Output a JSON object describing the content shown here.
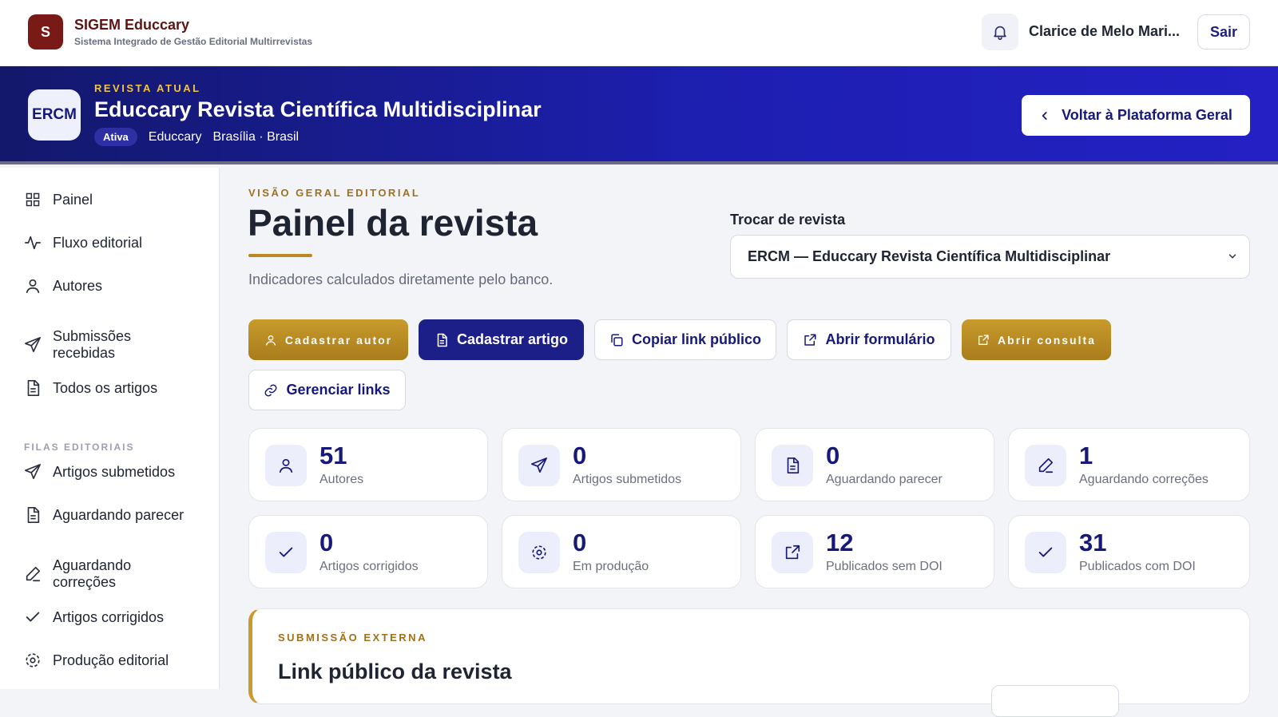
{
  "app": {
    "logo_letter": "S",
    "name": "SIGEM Educcary",
    "subtitle": "Sistema Integrado de Gestão Editorial Multirrevistas",
    "user_name": "Clarice de Melo Mari...",
    "logout_label": "Sair"
  },
  "journal": {
    "kicker": "REVISTA ATUAL",
    "badge": "ERCM",
    "title": "Educcary Revista Científica Multidisciplinar",
    "status": "Ativa",
    "publisher": "Educcary",
    "location": "Brasília · Brasil",
    "back_label": "Voltar à Plataforma Geral"
  },
  "sidebar": {
    "items": [
      {
        "label": "Painel",
        "icon": "grid-icon"
      },
      {
        "label": "Fluxo editorial",
        "icon": "activity-icon"
      },
      {
        "label": "Autores",
        "icon": "user-icon"
      },
      {
        "label": "Submissões recebidas",
        "icon": "send-icon"
      },
      {
        "label": "Todos os artigos",
        "icon": "document-icon"
      }
    ],
    "section_title": "FILAS EDITORIAIS",
    "queue_items": [
      {
        "label": "Artigos submetidos",
        "icon": "send-icon"
      },
      {
        "label": "Aguardando parecer",
        "icon": "document-icon"
      },
      {
        "label": "Aguardando correções",
        "icon": "pen-icon"
      },
      {
        "label": "Artigos corrigidos",
        "icon": "check-icon"
      },
      {
        "label": "Produção editorial",
        "icon": "gear-icon"
      }
    ]
  },
  "main": {
    "kicker": "VISÃO GERAL EDITORIAL",
    "title": "Painel da revista",
    "subtitle": "Indicadores calculados diretamente pelo banco.",
    "switch_label": "Trocar de revista",
    "switch_value": "ERCM — Educcary Revista Científica Multidisciplinar",
    "actions": {
      "add_author": "Cadastrar autor",
      "add_article": "Cadastrar artigo",
      "copy_link": "Copiar link público",
      "open_form": "Abrir formulário",
      "open_query": "Abrir consulta",
      "manage_links": "Gerenciar links"
    },
    "stats": [
      {
        "value": "51",
        "label": "Autores",
        "icon": "user-icon"
      },
      {
        "value": "0",
        "label": "Artigos submetidos",
        "icon": "send-icon"
      },
      {
        "value": "0",
        "label": "Aguardando parecer",
        "icon": "document-icon"
      },
      {
        "value": "1",
        "label": "Aguardando correções",
        "icon": "pen-icon"
      },
      {
        "value": "0",
        "label": "Artigos corrigidos",
        "icon": "check-icon"
      },
      {
        "value": "0",
        "label": "Em produção",
        "icon": "gear-icon"
      },
      {
        "value": "12",
        "label": "Publicados sem DOI",
        "icon": "external-link-icon"
      },
      {
        "value": "31",
        "label": "Publicados com DOI",
        "icon": "check-icon"
      }
    ],
    "external": {
      "kicker": "SUBMISSÃO EXTERNA",
      "title": "Link público da revista"
    }
  },
  "colors": {
    "brand_dark_red": "#7a1a17",
    "navy": "#16197a",
    "gold": "#c89b2c",
    "banner_gradient_end": "#2420c4"
  }
}
